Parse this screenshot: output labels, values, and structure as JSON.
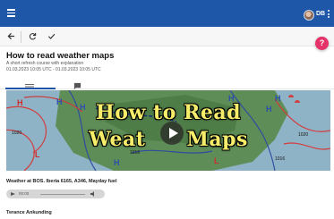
{
  "header": {
    "user_initials": "DB",
    "accent_color": "#1e57a7"
  },
  "toolbar": {
    "back_icon": "arrow-left-icon",
    "refresh_icon": "refresh-icon",
    "check_icon": "check-icon"
  },
  "help": {
    "label": "?"
  },
  "course": {
    "title": "How to read weather maps",
    "subtitle": "A short refresh course with explanation",
    "date_range": "01.03.2023 10:05 UTC - 01.03.2023 10:05 UTC"
  },
  "tabs": [
    {
      "icon": "list-icon",
      "active": true
    },
    {
      "icon": "chat-icon",
      "active": false
    }
  ],
  "video": {
    "title_line1": "How to Read",
    "title_line2_a": "Weat",
    "title_line2_b": "Maps",
    "pressure_labels": [
      "1020",
      "1020",
      "1016",
      "1016",
      "1012"
    ]
  },
  "tracks": [
    {
      "title": "Weather at BOS. Iberia 6165, A346, Mayday fuel",
      "time": "00:00",
      "progress": 0
    },
    {
      "title": "Terance Ankunding"
    }
  ]
}
